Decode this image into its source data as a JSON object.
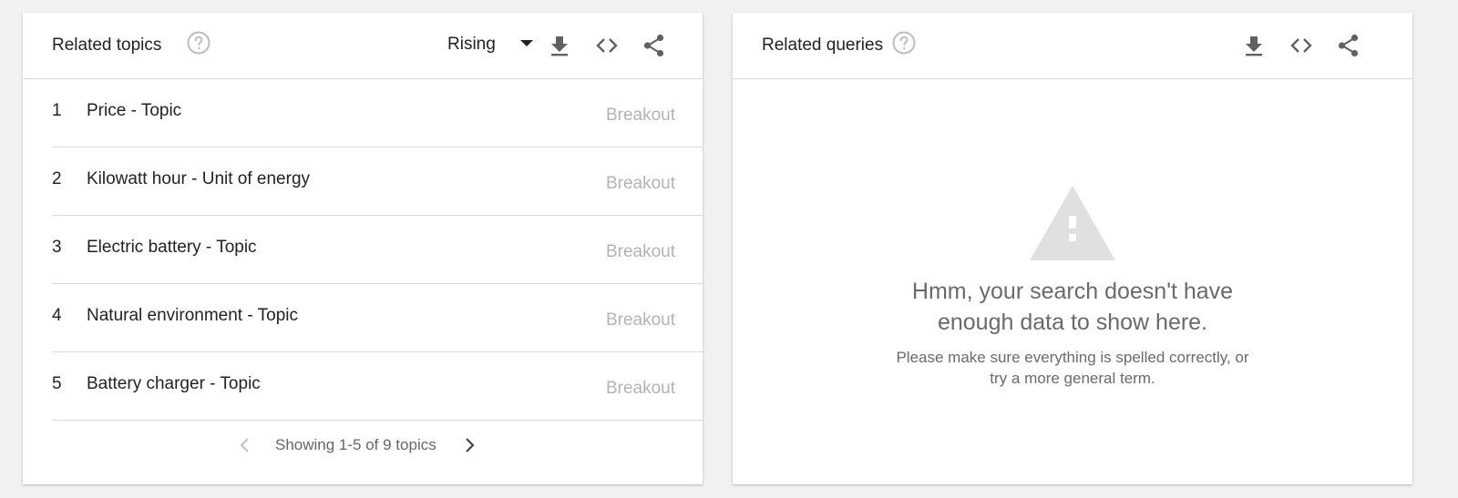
{
  "related_topics": {
    "title": "Related topics",
    "help_icon": "help-circle-icon",
    "filter": {
      "selected": "Rising",
      "icon": "caret-down-icon"
    },
    "toolbar": [
      "download-icon",
      "embed-code-icon",
      "share-icon"
    ],
    "rows": [
      {
        "rank": "1",
        "label": "Price - Topic",
        "value": "Breakout"
      },
      {
        "rank": "2",
        "label": "Kilowatt hour - Unit of energy",
        "value": "Breakout"
      },
      {
        "rank": "3",
        "label": "Electric battery - Topic",
        "value": "Breakout"
      },
      {
        "rank": "4",
        "label": "Natural environment - Topic",
        "value": "Breakout"
      },
      {
        "rank": "5",
        "label": "Battery charger - Topic",
        "value": "Breakout"
      }
    ],
    "pager": {
      "text": "Showing 1-5 of 9 topics",
      "prev_icon": "chevron-left-icon",
      "next_icon": "chevron-right-icon"
    }
  },
  "related_queries": {
    "title": "Related queries",
    "help_icon": "help-circle-icon",
    "toolbar": [
      "download-icon",
      "embed-code-icon",
      "share-icon"
    ],
    "empty_state": {
      "icon": "warning-icon",
      "title_line1": "Hmm, your search doesn't have",
      "title_line2": "enough data to show here.",
      "subtitle_line1": "Please make sure everything is spelled correctly, or",
      "subtitle_line2": "try a more general term."
    }
  },
  "colors": {
    "background": "#f1f1f1",
    "card": "#ffffff",
    "divider": "#dadada",
    "muted_value": "#b3b3b3",
    "icon": "#616161",
    "warning_icon": "#e0e0e0"
  }
}
